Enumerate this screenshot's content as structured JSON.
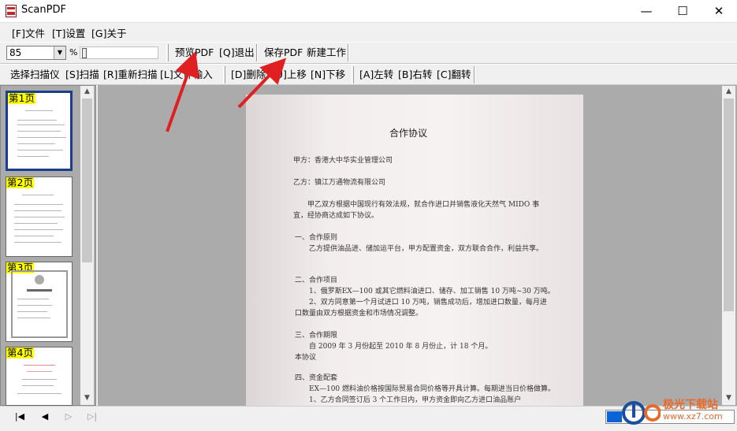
{
  "window": {
    "title": "ScanPDF",
    "minimize": "—",
    "maximize": "☐",
    "close": "✕"
  },
  "menu": [
    {
      "label": "[F]文件"
    },
    {
      "label": "[T]设置"
    },
    {
      "label": "[G]关于"
    }
  ],
  "toolbar1": {
    "zoom_value": "85",
    "zoom_unit": "%",
    "preview_pdf": "预览PDF",
    "quit": "[Q]退出",
    "save_pdf": "保存PDF",
    "new_job": "新建工作"
  },
  "toolbar2": {
    "select_scanner": "选择扫描仪",
    "scan": "[S]扫描",
    "rescan": "[R]重新扫描",
    "import_file": "[L]文件输入",
    "delete": "[D]删除",
    "move_up": "[U]上移",
    "move_down": "[N]下移",
    "rotate_left": "[A]左转",
    "rotate_right": "[B]右转",
    "flip": "[C]翻转"
  },
  "thumbnails": [
    {
      "label": "第1页",
      "selected": true
    },
    {
      "label": "第2页",
      "selected": false
    },
    {
      "label": "第3页",
      "selected": false
    },
    {
      "label": "第4页",
      "selected": false
    }
  ],
  "document": {
    "title": "合作协议",
    "lines": [
      "甲方：香港大中华实业管理公司",
      "乙方：镇江万通物流有限公司",
      "甲乙双方根据中国现行有效法规，就合作进口并销售液化天然气 MIDO 事",
      "宜，经协商达成如下协议。",
      "一、合作原则",
      "乙方提供油品进、储加运平台，甲方配置资金，双方联合合作，利益共享。",
      "二、合作项目",
      "1、俄罗斯EX—100 或其它燃料油进口、储存、加工销售 10 万吨~30 万吨。",
      "2、双方同意第一个月试进口 10 万吨，销售成功后，增加进口数量，每月进",
      "口数量由双方根据资金和市场情况调整。",
      "三、合作期限",
      "自 2009 年 3 月份起至 2010 年 8 月份止，计 18 个月。",
      "本协议",
      "四、资金配套",
      "EX—100 燃料油价格按国际贸易合同价格等开具计算。每期进当日价格做算。",
      "1、乙方合同签订后 3 个工作日内，甲方资金即向乙方进口油品账户"
    ]
  },
  "nav": {
    "first": "|◀",
    "prev": "◀",
    "next": "▷",
    "last": "▷|"
  },
  "progress": {
    "fraction": 0.12
  },
  "watermark": {
    "line1": "极光下载站",
    "line2": "www.xz7.com"
  },
  "colors": {
    "selected_border": "#1a3e8c",
    "thumb_label_bg": "#ffff00",
    "arrow": "#e02020",
    "progress": "#0a64d8"
  }
}
